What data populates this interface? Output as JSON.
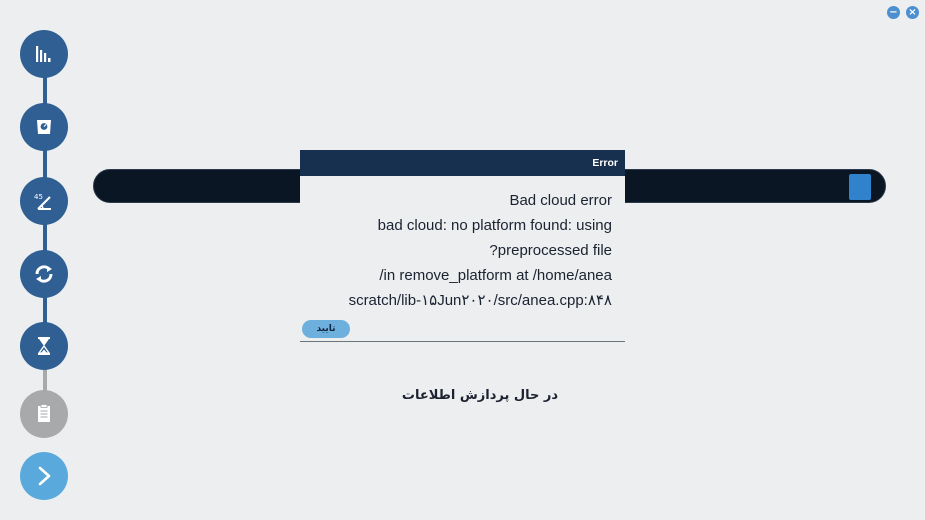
{
  "window": {
    "minimize_icon": "minus-icon",
    "close_icon": "close-icon",
    "minimize_glyph": "−",
    "close_glyph": "×"
  },
  "steps": [
    {
      "icon": "bar-chart-icon",
      "state": "active"
    },
    {
      "icon": "scale-icon",
      "state": "active"
    },
    {
      "icon": "angle-icon",
      "state": "active"
    },
    {
      "icon": "refresh-icon",
      "state": "active"
    },
    {
      "icon": "hourglass-icon",
      "state": "active"
    },
    {
      "icon": "clipboard-icon",
      "state": "disabled"
    },
    {
      "icon": "chevron-right-icon",
      "state": "next"
    }
  ],
  "progress": {
    "fraction": 0.97
  },
  "dialog": {
    "title": "Error",
    "lines": [
      "Bad cloud error",
      "bad cloud: no platform found: using",
      "preprocessed file?",
      "in remove_platform at /home/anea/",
      "scratch/lib-۱۵Jun۲۰۲۰/src/anea.cpp:۸۴۸"
    ],
    "ok_label": "تایید"
  },
  "status": "در حال پردازش اطلاعات",
  "colors": {
    "background": "#eceef0",
    "step_active": "#2f5f93",
    "step_disabled": "#a7a9ab",
    "step_next": "#5aa9dc",
    "dialog_header": "#17304f",
    "progress_track": "#0a1624",
    "progress_fill": "#2f82cb"
  }
}
